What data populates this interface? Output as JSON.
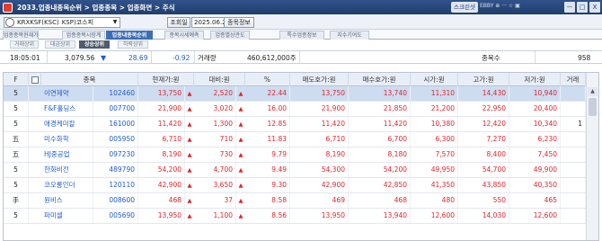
{
  "title": {
    "text": "2033.업종내종목순위 > 업종종목 > 업종화면 > 주식",
    "badge": "스크린샷",
    "sub": "EBBY ⊕ ··· ☆ ▣",
    "buttons": [
      "ㅡ",
      "□",
      "X"
    ]
  },
  "toolbar": {
    "code": "KRXKSF(KSC)",
    "market": "KSP)코스피",
    "query_label": "조회일",
    "date": "2025.06.20",
    "stock_info": "종목정보"
  },
  "tabs": [
    "업종종목현재가",
    "업종종목시장계",
    "업종내종목순위",
    "종목시세예측",
    "업종별상관도",
    "특수업종정보",
    "지수기여도"
  ],
  "subtabs": [
    "거래상위",
    "대금상위",
    "상승상위",
    "하락상위"
  ],
  "info": {
    "time": "18:05:01",
    "index": "3,079.56",
    "change": "28.69",
    "rate": "-0.92",
    "volume_label": "거래량",
    "volume": "460,612,000주",
    "count_label": "종목수",
    "count": "958"
  },
  "columns": {
    "f": "F",
    "stock": "종목",
    "price": "현재가:원",
    "diff": "대비:원",
    "pct": "%",
    "ask": "매도호가:원",
    "bid": "매수호가:원",
    "open": "시가:원",
    "high": "고가:원",
    "low": "저가:원",
    "vol": "거래"
  },
  "rows": [
    {
      "f": "5",
      "name": "이연제약",
      "code": "102460",
      "price": "13,750",
      "diff": "2,520",
      "pct": "22.44",
      "ask": "13,750",
      "bid": "13,740",
      "open": "11,310",
      "high": "14,430",
      "low": "10,940",
      "vol": ""
    },
    {
      "f": "5",
      "name": "F&F홀딩스",
      "code": "007700",
      "price": "21,900",
      "diff": "3,020",
      "pct": "16.00",
      "ask": "21,900",
      "bid": "21,850",
      "open": "21,200",
      "high": "22,950",
      "low": "20,400",
      "vol": ""
    },
    {
      "f": "5",
      "name": "애경케미칼",
      "code": "161000",
      "price": "11,420",
      "diff": "1,300",
      "pct": "12.85",
      "ask": "11,420",
      "bid": "11,420",
      "open": "10,380",
      "high": "12,420",
      "low": "10,340",
      "vol": "1"
    },
    {
      "f": "五",
      "name": "미수화학",
      "code": "005950",
      "price": "6,710",
      "diff": "710",
      "pct": "11.83",
      "ask": "6,710",
      "bid": "6,700",
      "open": "6,300",
      "high": "7,270",
      "low": "6,230",
      "vol": ""
    },
    {
      "f": "五",
      "name": "HJ중공업",
      "code": "097230",
      "price": "8,190",
      "diff": "730",
      "pct": "9.79",
      "ask": "8,190",
      "bid": "8,180",
      "open": "7,570",
      "high": "8,400",
      "low": "7,450",
      "vol": ""
    },
    {
      "f": "5",
      "name": "한화비전",
      "code": "489790",
      "price": "54,200",
      "diff": "4,700",
      "pct": "9.49",
      "ask": "54,300",
      "bid": "54,200",
      "open": "49,950",
      "high": "54,700",
      "low": "49,900",
      "vol": ""
    },
    {
      "f": "5",
      "name": "코오롱인더",
      "code": "120110",
      "price": "42,900",
      "diff": "3,650",
      "pct": "9.30",
      "ask": "42,900",
      "bid": "42,850",
      "open": "41,350",
      "high": "43,850",
      "low": "40,350",
      "vol": ""
    },
    {
      "f": "手",
      "name": "원비스",
      "code": "008600",
      "price": "468",
      "diff": "37",
      "pct": "8.58",
      "ask": "469",
      "bid": "468",
      "open": "480",
      "high": "550",
      "low": "465",
      "vol": ""
    },
    {
      "f": "5",
      "name": "파미셀",
      "code": "005690",
      "price": "13,950",
      "diff": "1,100",
      "pct": "8.56",
      "ask": "13,950",
      "bid": "13,940",
      "open": "12,600",
      "high": "14,030",
      "low": "12,600",
      "vol": ""
    }
  ]
}
